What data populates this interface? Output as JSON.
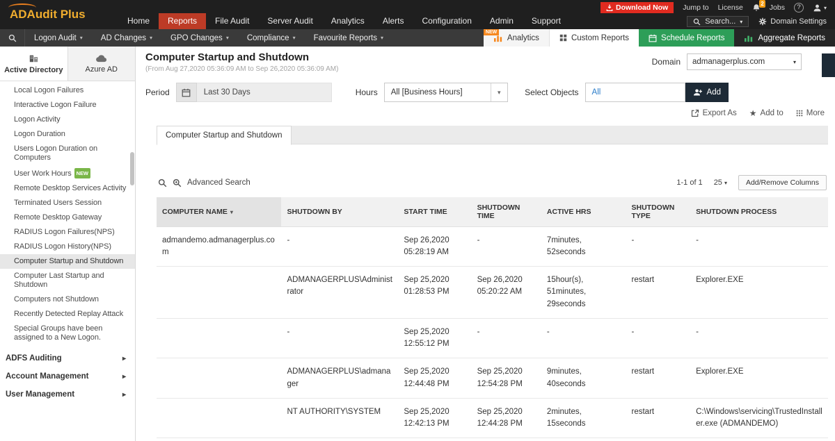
{
  "header": {
    "logo": "ADAudit Plus",
    "nav": [
      "Home",
      "Reports",
      "File Audit",
      "Server Audit",
      "Analytics",
      "Alerts",
      "Configuration",
      "Admin",
      "Support"
    ],
    "download_now": "Download Now",
    "jump_to": "Jump to",
    "license": "License",
    "notification_count": "2",
    "jobs": "Jobs",
    "help": "?",
    "search": "Search...",
    "domain_settings": "Domain Settings"
  },
  "menubar": {
    "items": [
      "Logon Audit",
      "AD Changes",
      "GPO Changes",
      "Compliance",
      "Favourite Reports"
    ],
    "new_badge": "NEW",
    "analytics": "Analytics",
    "custom_reports": "Custom Reports",
    "schedule_reports": "Schedule Reports",
    "aggregate_reports": "Aggregate Reports"
  },
  "sidebar": {
    "tabs": [
      {
        "label": "Active Directory"
      },
      {
        "label": "Azure AD"
      }
    ],
    "items": [
      "Local Logon Failures",
      "Interactive Logon Failure",
      "Logon Activity",
      "Logon Duration",
      "Users Logon Duration on Computers",
      "User Work Hours",
      "Remote Desktop Services Activity",
      "Terminated Users Session",
      "Remote Desktop Gateway",
      "RADIUS Logon Failures(NPS)",
      "RADIUS Logon History(NPS)",
      "Computer Startup and Shutdown",
      "Computer Last Startup and Shutdown",
      "Computers not Shutdown",
      "Recently Detected Replay Attack",
      "Special Groups have been assigned to a New Logon."
    ],
    "new_badge": "NEW",
    "selected_item": "Computer Startup and Shutdown",
    "sections": [
      "ADFS Auditing",
      "Account Management",
      "User Management"
    ]
  },
  "report": {
    "title": "Computer Startup and Shutdown",
    "subtitle": "(From Aug 27,2020 05:36:09 AM to Sep 26,2020 05:36:09 AM)",
    "domain_label": "Domain",
    "domain_value": "admanagerplus.com",
    "period_label": "Period",
    "period_value": "Last 30 Days",
    "hours_label": "Hours",
    "hours_value": "All [Business Hours]",
    "select_objects_label": "Select Objects",
    "select_objects_value": "All",
    "add_button": "Add",
    "export_as": "Export As",
    "add_to": "Add to",
    "more": "More",
    "tab": "Computer Startup and Shutdown"
  },
  "table": {
    "advanced_search": "Advanced Search",
    "pagination": "1-1 of 1",
    "page_size": "25",
    "add_remove_columns": "Add/Remove Columns",
    "headers": [
      "COMPUTER NAME",
      "SHUTDOWN BY",
      "START TIME",
      "SHUTDOWN TIME",
      "ACTIVE HRS",
      "SHUTDOWN TYPE",
      "SHUTDOWN PROCESS"
    ],
    "rows": [
      [
        "admandemo.admanagerplus.com",
        "-",
        "Sep 26,2020 05:28:19 AM",
        "-",
        "7minutes, 52seconds",
        "-",
        "-"
      ],
      [
        "",
        "ADMANAGERPLUS\\Administrator",
        "Sep 25,2020 01:28:53 PM",
        "Sep 26,2020 05:20:22 AM",
        "15hour(s), 51minutes, 29seconds",
        "restart",
        "Explorer.EXE"
      ],
      [
        "",
        "-",
        "Sep 25,2020 12:55:12 PM",
        "-",
        "-",
        "-",
        "-"
      ],
      [
        "",
        "ADMANAGERPLUS\\admanager",
        "Sep 25,2020 12:44:48 PM",
        "Sep 25,2020 12:54:28 PM",
        "9minutes, 40seconds",
        "restart",
        "Explorer.EXE"
      ],
      [
        "",
        "NT AUTHORITY\\SYSTEM",
        "Sep 25,2020 12:42:13 PM",
        "Sep 25,2020 12:44:28 PM",
        "2minutes, 15seconds",
        "restart",
        "C:\\Windows\\servicing\\TrustedInstaller.exe (ADMANDEMO)"
      ]
    ]
  },
  "colors": {
    "nav_active": "#bd3b26",
    "download_red": "#e12b20",
    "schedule_green": "#2d9e58",
    "new_orange": "#f6881f",
    "new_green": "#7ab648",
    "dark_button": "#1d2a36"
  }
}
